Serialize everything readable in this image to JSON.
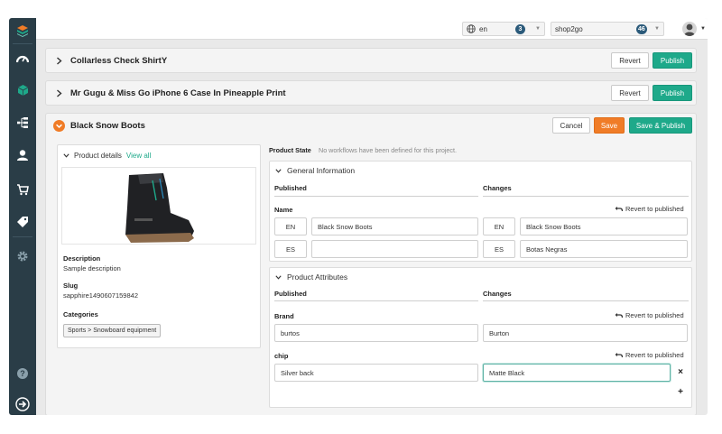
{
  "topbar": {
    "language": "en",
    "language_count": "3",
    "project": "shop2go",
    "project_count": "46"
  },
  "sidebar": {
    "icons": [
      "logo-icon",
      "dashboard-icon",
      "products-icon",
      "categories-icon",
      "customers-icon",
      "orders-icon",
      "discounts-icon",
      "settings-icon",
      "help-icon",
      "expand-icon"
    ]
  },
  "collapsed_products": [
    {
      "title": "Collarless Check ShirtY",
      "revert_label": "Revert",
      "publish_label": "Publish"
    },
    {
      "title": "Mr Gugu & Miss Go iPhone 6 Case In Pineapple Print",
      "revert_label": "Revert",
      "publish_label": "Publish"
    }
  ],
  "editor": {
    "title": "Black Snow Boots",
    "cancel_label": "Cancel",
    "save_label": "Save",
    "save_publish_label": "Save & Publish"
  },
  "details": {
    "header": "Product details",
    "view_all": "View all",
    "description_label": "Description",
    "description_value": "Sample description",
    "slug_label": "Slug",
    "slug_value": "sapphire1490607159842",
    "categories_label": "Categories",
    "category_tag": "Sports > Snowboard equipment"
  },
  "product_state": {
    "label": "Product State",
    "message": "No workflows have been defined for this project."
  },
  "general": {
    "header": "General Information",
    "published_col": "Published",
    "changes_col": "Changes",
    "name_label": "Name",
    "revert_label": "Revert to published",
    "rows": [
      {
        "lang_pub": "EN",
        "published": "Black Snow Boots",
        "lang_chg": "EN",
        "changes": "Black Snow Boots"
      },
      {
        "lang_pub": "ES",
        "published": "",
        "lang_chg": "ES",
        "changes": "Botas Negras"
      }
    ]
  },
  "attributes": {
    "header": "Product Attributes",
    "published_col": "Published",
    "changes_col": "Changes",
    "brand_label": "Brand",
    "brand_published": "burtos",
    "brand_changes": "Burton",
    "chip_label": "chip",
    "chip_published": "Silver back",
    "chip_changes": "Matte Black",
    "revert_label": "Revert to published",
    "remove_symbol": "×",
    "add_symbol": "+"
  },
  "colors": {
    "sidebar": "#2a3d47",
    "accent_green": "#1ea98a",
    "accent_orange": "#f07c27",
    "badge": "#2b5a7a"
  }
}
